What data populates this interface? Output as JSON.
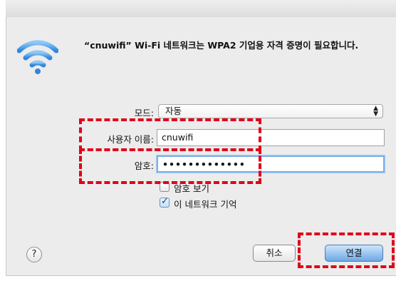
{
  "dialog": {
    "message": "“cnuwifi” Wi-Fi 네트워크는 WPA2 기업용 자격 증명이 필요합니다."
  },
  "form": {
    "mode_label": "모드:",
    "mode_value": "자동",
    "username_label": "사용자 이름:",
    "username_value": "cnuwifi",
    "password_label": "암호:",
    "password_mask": "•••••••••••••"
  },
  "options": {
    "show_password_label": "암호 보기",
    "show_password_checked": false,
    "remember_label": "이 네트워크 기억",
    "remember_checked": true
  },
  "buttons": {
    "help_symbol": "?",
    "cancel_label": "취소",
    "connect_label": "연결"
  },
  "annotations": {
    "color": "#e0001b"
  },
  "icons": {
    "wifi": "wifi-icon",
    "help": "question-icon",
    "checkmark": "check-icon"
  }
}
